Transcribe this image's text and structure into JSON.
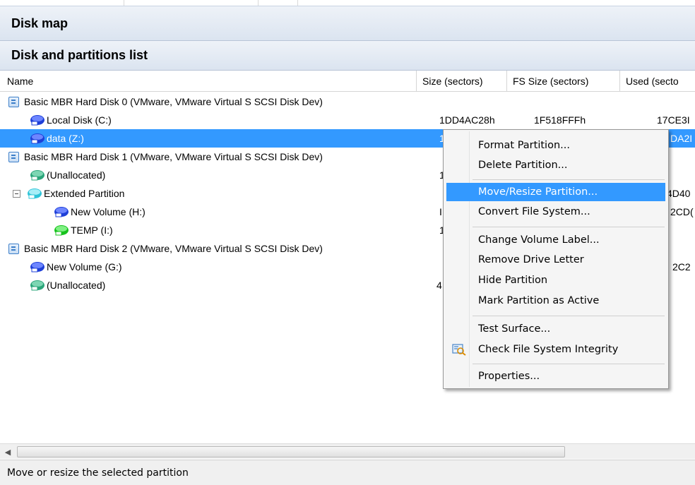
{
  "headers": {
    "disk_map": "Disk map",
    "partitions_list": "Disk and partitions list"
  },
  "columns": [
    "Name",
    "Size (sectors)",
    "FS Size (sectors)",
    "Used (secto"
  ],
  "rows": [
    {
      "type": "disk",
      "name": "Basic MBR Hard Disk 0 (VMware, VMware Virtual S SCSI Disk Dev)",
      "size": "",
      "fs_size": "",
      "used": ""
    },
    {
      "type": "volume",
      "name": "Local Disk (C:)",
      "size": "1DD4AC28h",
      "fs_size": "1F518FFFh",
      "used": "17CE3I",
      "icon_color": "#1e3fd8"
    },
    {
      "type": "volume",
      "name": "data (Z:)",
      "size": "1",
      "fs_size": "",
      "used": "DA2I",
      "icon_color": "#1e3fd8"
    },
    {
      "type": "disk",
      "name": "Basic MBR Hard Disk 1 (VMware, VMware Virtual S SCSI Disk Dev)",
      "size": "",
      "fs_size": "",
      "used": ""
    },
    {
      "type": "volume",
      "name": "(Unallocated)",
      "size": "1",
      "fs_size": "",
      "used": "",
      "icon_color": "#2aa57a"
    },
    {
      "type": "extended",
      "name": "Extended Partition",
      "size": "",
      "fs_size": "",
      "used": "4D40",
      "icon_color": "#2ec4d8"
    },
    {
      "type": "volume",
      "name": "New Volume (H:)",
      "size": "I",
      "fs_size": "",
      "used": "2CD(",
      "icon_color": "#1e3fd8"
    },
    {
      "type": "volume",
      "name": "TEMP (I:)",
      "size": "1",
      "fs_size": "",
      "used": "",
      "icon_color": "#17c21d"
    },
    {
      "type": "disk",
      "name": "Basic MBR Hard Disk 2 (VMware, VMware Virtual S SCSI Disk Dev)",
      "size": "",
      "fs_size": "",
      "used": ""
    },
    {
      "type": "volume",
      "name": "New Volume (G:)",
      "size": "",
      "fs_size": "",
      "used": "2C2",
      "icon_color": "#1e3fd8"
    },
    {
      "type": "volume",
      "name": "(Unallocated)",
      "size": "4",
      "fs_size": "",
      "used": "",
      "icon_color": "#2aa57a"
    }
  ],
  "context_menu": {
    "format": "Format Partition...",
    "delete": "Delete Partition...",
    "move_resize": "Move/Resize Partition...",
    "convert_fs": "Convert File System...",
    "change_label": "Change Volume Label...",
    "remove_letter": "Remove Drive Letter",
    "hide": "Hide Partition",
    "mark_active": "Mark Partition as Active",
    "test_surface": "Test Surface...",
    "check_fs": "Check File System Integrity",
    "properties": "Properties..."
  },
  "status": "Move or resize the selected partition",
  "colors": {
    "selection": "#3399ff",
    "header_bg": "#dbe4f0"
  }
}
